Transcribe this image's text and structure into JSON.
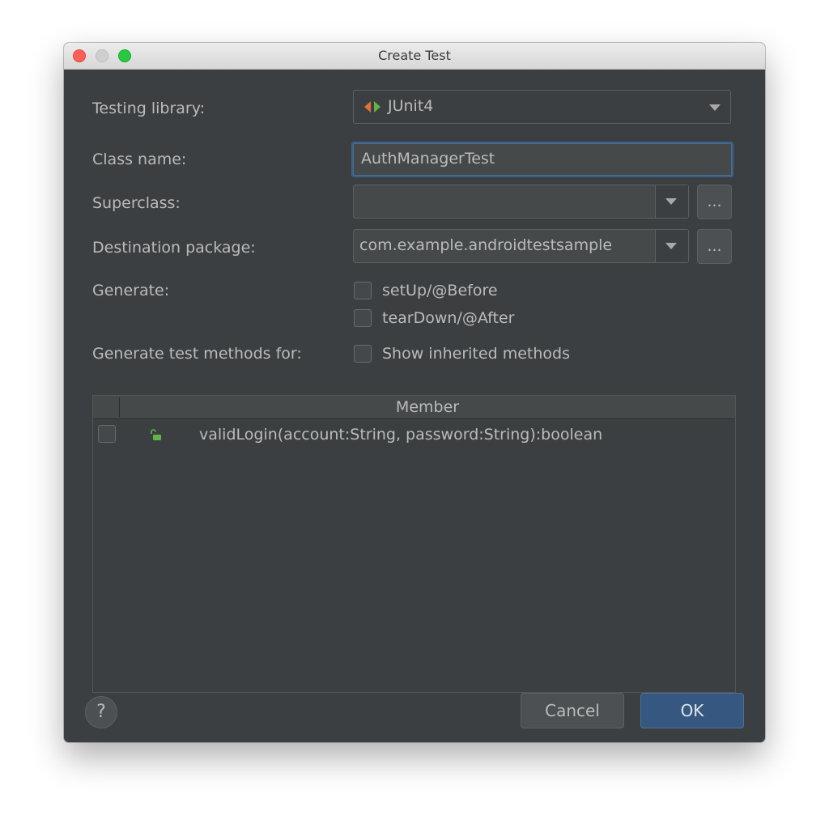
{
  "window": {
    "title": "Create Test"
  },
  "form": {
    "testing_library_label": "Testing library:",
    "testing_library_value": "JUnit4",
    "class_name_label": "Class name:",
    "class_name_value": "AuthManagerTest",
    "superclass_label": "Superclass:",
    "superclass_value": "",
    "destination_package_label": "Destination package:",
    "destination_package_value": "com.example.androidtestsample",
    "browse_label": "...",
    "generate_label": "Generate:",
    "generate_options": [
      {
        "label": "setUp/@Before",
        "checked": false
      },
      {
        "label": "tearDown/@After",
        "checked": false
      }
    ],
    "methods_label": "Generate test methods for:",
    "show_inherited_label": "Show inherited methods",
    "show_inherited_checked": false
  },
  "table": {
    "column_header": "Member",
    "rows": [
      {
        "member": "validLogin(account:String, password:String):boolean",
        "checked": false
      }
    ]
  },
  "footer": {
    "help_label": "?",
    "cancel_label": "Cancel",
    "ok_label": "OK"
  },
  "colors": {
    "dialog_background": "#3c3f41",
    "primary_button": "#365880",
    "focus_border": "#3d6185",
    "lock_icon": "#62b543"
  },
  "icons": {
    "junit": "junit-icon",
    "member_access": "unlocked-icon",
    "dropdown": "chevron-down-icon"
  }
}
